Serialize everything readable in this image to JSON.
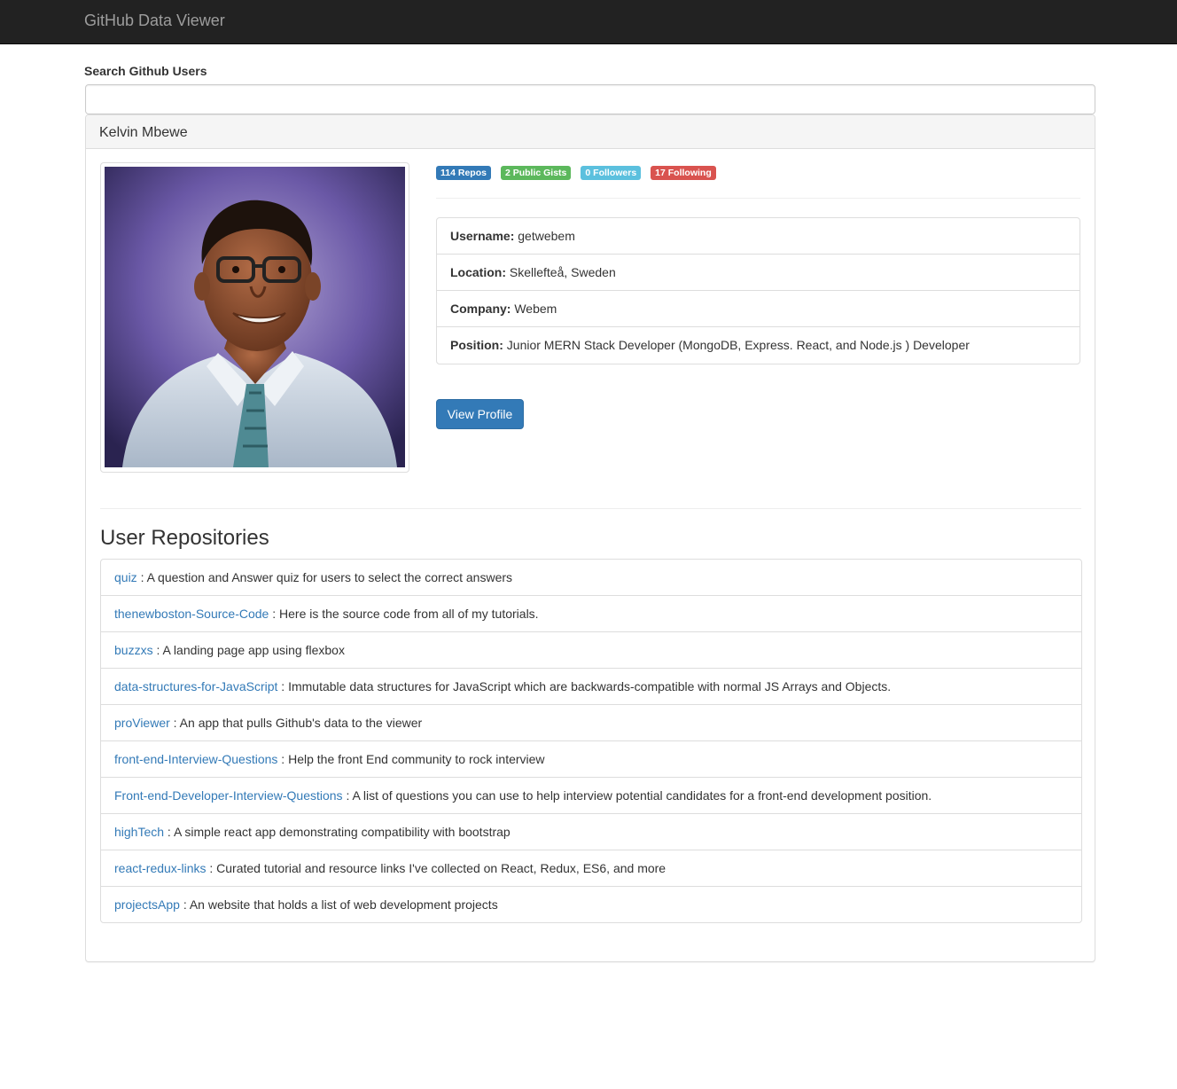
{
  "navbar": {
    "brand": "GitHub Data Viewer"
  },
  "search": {
    "label": "Search Github Users",
    "value": "",
    "placeholder": ""
  },
  "profile": {
    "name": "Kelvin Mbewe",
    "badges": [
      {
        "text": "114 Repos",
        "color": "#337ab7"
      },
      {
        "text": "2 Public Gists",
        "color": "#5cb85c"
      },
      {
        "text": "0 Followers",
        "color": "#5bc0de"
      },
      {
        "text": "17 Following",
        "color": "#d9534f"
      }
    ],
    "details": [
      {
        "label": "Username:",
        "value": " getwebem"
      },
      {
        "label": "Location:",
        "value": " Skellefteå, Sweden"
      },
      {
        "label": "Company:",
        "value": " Webem"
      },
      {
        "label": "Position:",
        "value": " Junior MERN Stack Developer (MongoDB, Express. React, and Node.js ) Developer"
      }
    ],
    "view_profile_label": "View Profile"
  },
  "repositories": {
    "title": "User Repositories",
    "items": [
      {
        "name": "quiz",
        "description": " : A question and Answer quiz for users to select the correct answers"
      },
      {
        "name": "thenewboston-Source-Code",
        "description": " : Here is the source code from all of my tutorials."
      },
      {
        "name": "buzzxs",
        "description": " : A landing page app using flexbox"
      },
      {
        "name": "data-structures-for-JavaScript",
        "description": " : Immutable data structures for JavaScript which are backwards-compatible with normal JS Arrays and Objects."
      },
      {
        "name": "proViewer",
        "description": " : An app that pulls Github's data to the viewer"
      },
      {
        "name": "front-end-Interview-Questions",
        "description": " : Help the front End community to rock interview"
      },
      {
        "name": "Front-end-Developer-Interview-Questions",
        "description": " : A list of questions you can use to help interview potential candidates for a front-end development position."
      },
      {
        "name": "highTech",
        "description": " : A simple react app demonstrating compatibility with bootstrap"
      },
      {
        "name": "react-redux-links",
        "description": " : Curated tutorial and resource links I've collected on React, Redux, ES6, and more"
      },
      {
        "name": "projectsApp",
        "description": " : An website that holds a list of web development projects"
      }
    ]
  }
}
